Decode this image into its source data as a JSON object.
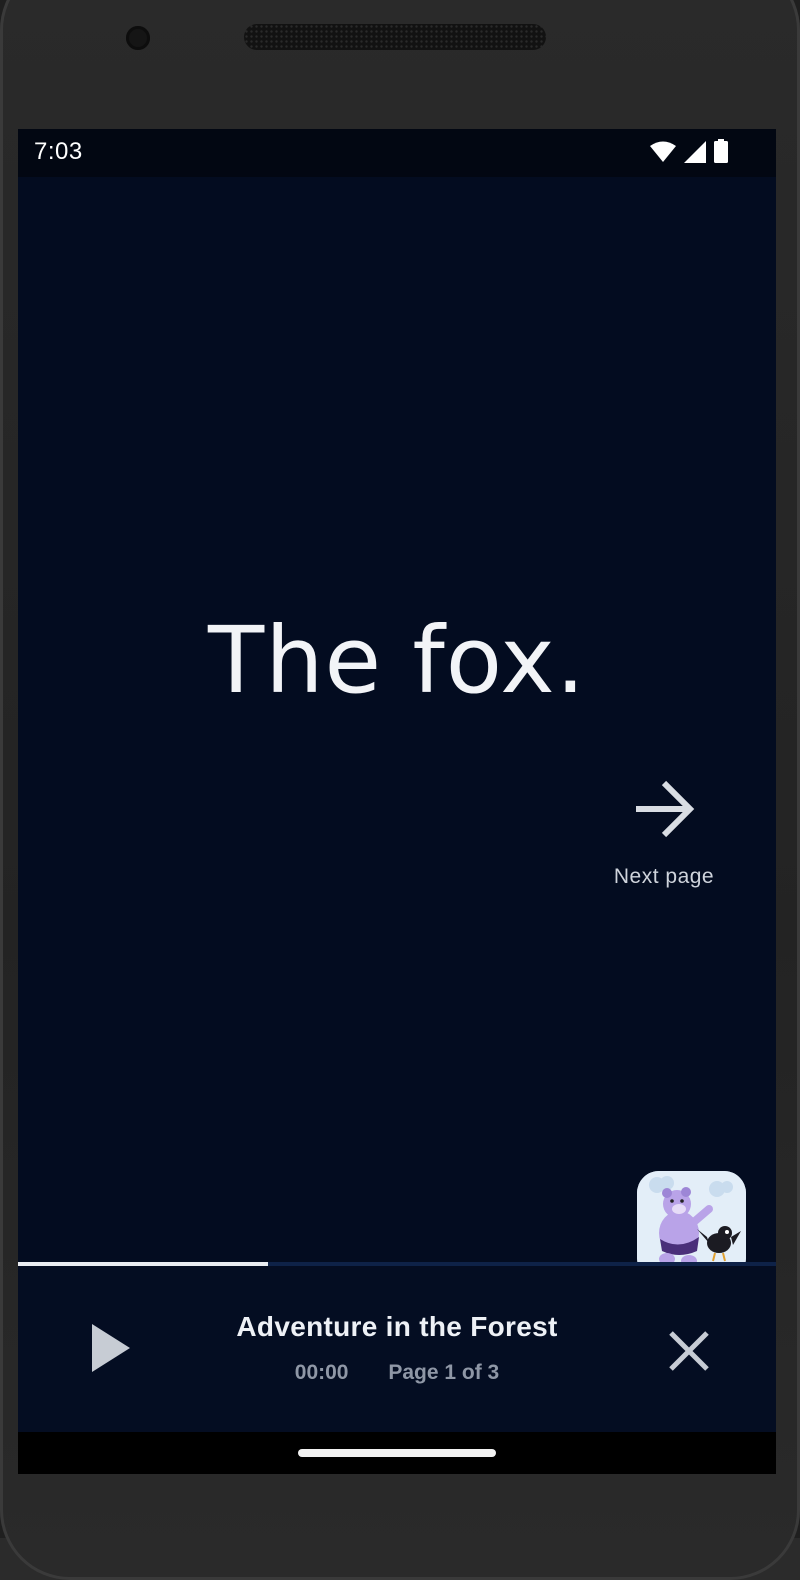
{
  "status_bar": {
    "time": "7:03",
    "icons": [
      "wifi-icon",
      "cell-signal-icon",
      "battery-icon"
    ]
  },
  "story": {
    "text": "The fox."
  },
  "next_page": {
    "label": "Next page",
    "icon": "arrow-right-icon"
  },
  "player": {
    "title": "Adventure in the Forest",
    "time": "00:00",
    "page_indicator": "Page 1 of 3",
    "progress": 0.33,
    "play_icon": "play-icon",
    "close_icon": "close-icon"
  },
  "colors": {
    "background": "#030c20",
    "progress_fill": "#e9ecf1",
    "progress_track": "#0e2248",
    "text_primary": "#f2f4f7",
    "text_muted": "#8f97a6"
  }
}
